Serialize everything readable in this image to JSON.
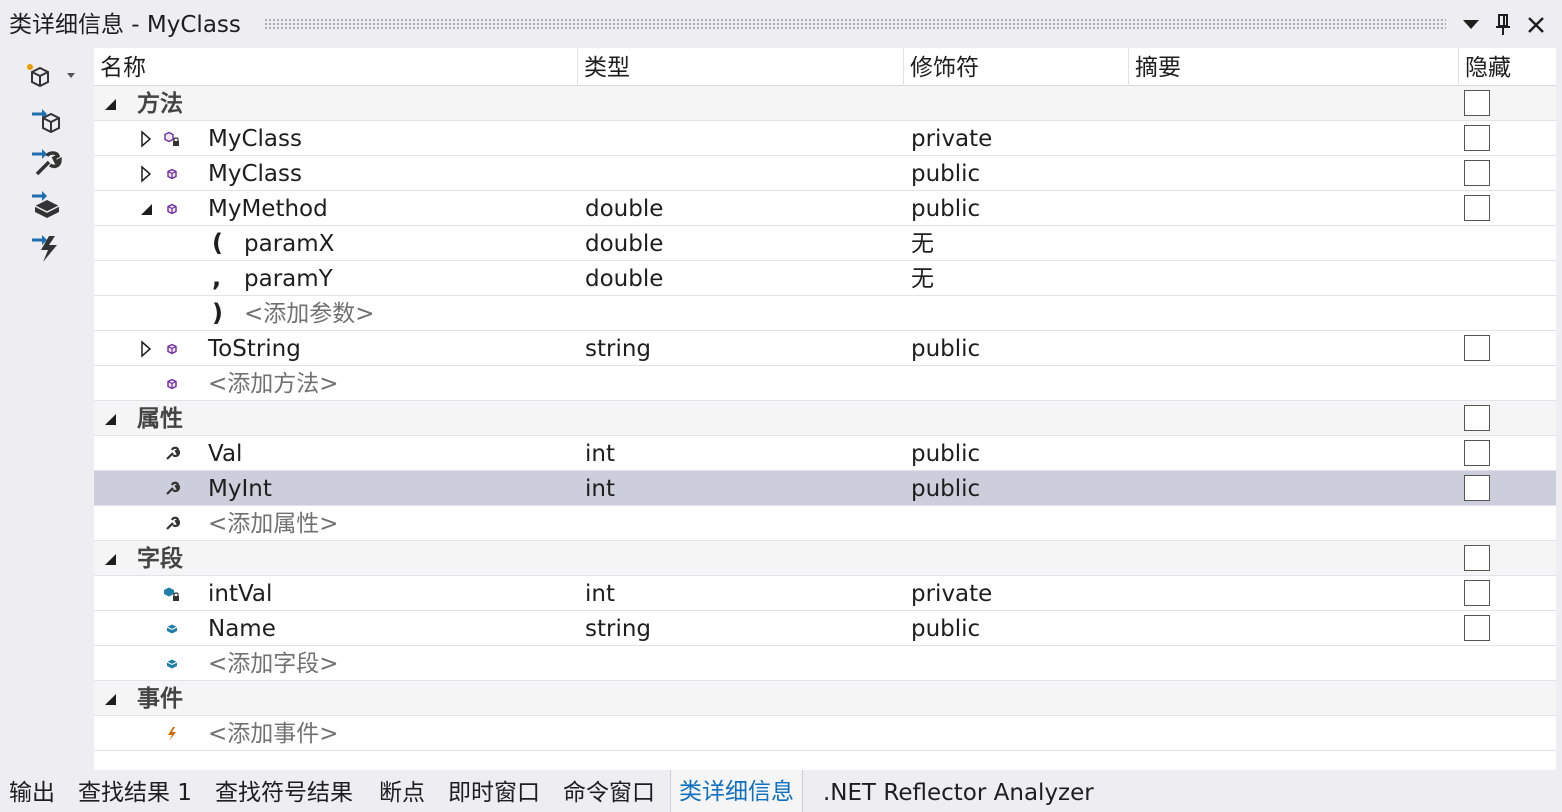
{
  "window": {
    "title": "类详细信息 - MyClass"
  },
  "title_buttons": [
    "dropdown-icon",
    "pin-icon",
    "close-icon"
  ],
  "toolbar": {
    "items": [
      "new-class-icon",
      "new-method-icon",
      "new-property-icon",
      "new-field-icon",
      "new-event-icon"
    ]
  },
  "columns": {
    "name": "名称",
    "type": "类型",
    "modifier": "修饰符",
    "summary": "摘要",
    "hide": "隐藏"
  },
  "rows": [
    {
      "kind": "group",
      "name": "方法",
      "expanded": true,
      "has_checkbox": true
    },
    {
      "kind": "member",
      "icon": "method-private-icon",
      "name": "MyClass",
      "type": "",
      "modifier": "private",
      "expanded": false,
      "has_checkbox": true
    },
    {
      "kind": "member",
      "icon": "method-icon",
      "name": "MyClass",
      "type": "",
      "modifier": "public",
      "expanded": false,
      "has_checkbox": true
    },
    {
      "kind": "member",
      "icon": "method-icon",
      "name": "MyMethod",
      "type": "double",
      "modifier": "public",
      "expanded": true,
      "has_checkbox": true
    },
    {
      "kind": "param",
      "prefix": "(",
      "name": "paramX",
      "type": "double",
      "modifier": "无"
    },
    {
      "kind": "param",
      "prefix": ",",
      "name": "paramY",
      "type": "double",
      "modifier": "无"
    },
    {
      "kind": "param-add",
      "prefix": ")",
      "name": "<添加参数>"
    },
    {
      "kind": "member",
      "icon": "method-icon",
      "name": "ToString",
      "type": "string",
      "modifier": "public",
      "expanded": false,
      "has_checkbox": true
    },
    {
      "kind": "add",
      "icon": "method-icon",
      "name": "<添加方法>"
    },
    {
      "kind": "group",
      "name": "属性",
      "expanded": true,
      "has_checkbox": true
    },
    {
      "kind": "member",
      "icon": "property-icon",
      "name": "Val",
      "type": "int",
      "modifier": "public",
      "has_checkbox": true
    },
    {
      "kind": "member",
      "icon": "property-icon",
      "name": "MyInt",
      "type": "int",
      "modifier": "public",
      "has_checkbox": true,
      "selected": true
    },
    {
      "kind": "add",
      "icon": "property-icon",
      "name": "<添加属性>"
    },
    {
      "kind": "group",
      "name": "字段",
      "expanded": true,
      "has_checkbox": true
    },
    {
      "kind": "member",
      "icon": "field-private-icon",
      "name": "intVal",
      "type": "int",
      "modifier": "private",
      "has_checkbox": true
    },
    {
      "kind": "member",
      "icon": "field-icon",
      "name": "Name",
      "type": "string",
      "modifier": "public",
      "has_checkbox": true
    },
    {
      "kind": "add",
      "icon": "field-icon",
      "name": "<添加字段>"
    },
    {
      "kind": "group",
      "name": "事件",
      "expanded": true,
      "has_checkbox": false
    },
    {
      "kind": "add",
      "icon": "event-icon",
      "name": "<添加事件>"
    }
  ],
  "tabs": [
    {
      "label": "输出",
      "active": false
    },
    {
      "label": "查找结果 1",
      "active": false
    },
    {
      "label": "查找符号结果",
      "active": false
    },
    {
      "label": "断点",
      "active": false
    },
    {
      "label": "即时窗口",
      "active": false
    },
    {
      "label": "命令窗口",
      "active": false
    },
    {
      "label": "类详细信息",
      "active": true
    },
    {
      "label": ".NET Reflector Analyzer",
      "active": false
    }
  ],
  "colors": {
    "accent": "#0E70C0",
    "selected_row": "#CCCEDB",
    "method_icon": "#6C2C9C",
    "field_icon": "#1F7FA8",
    "event_icon": "#D26A00"
  }
}
